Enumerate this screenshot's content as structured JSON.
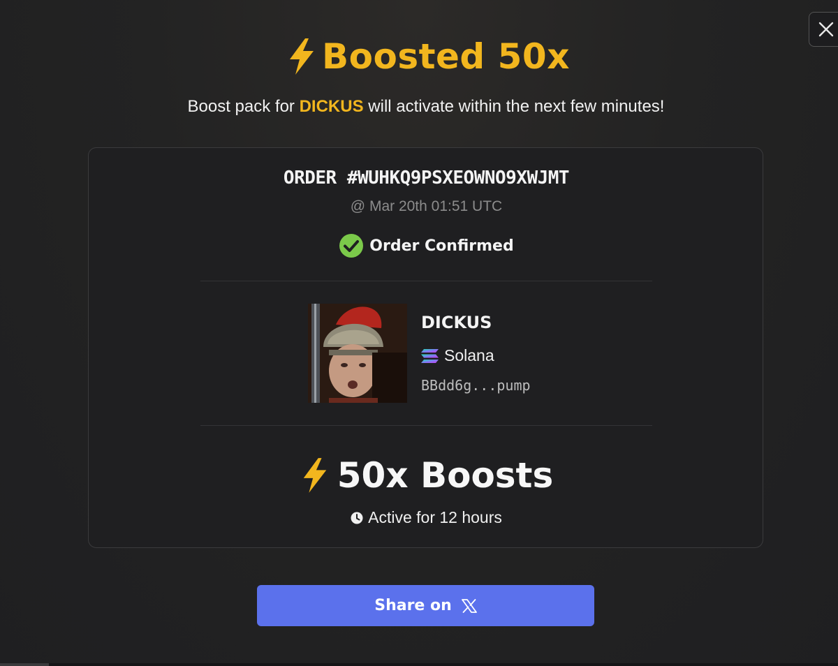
{
  "modal": {
    "title": "Boosted 50x",
    "subtitle_before": "Boost pack for ",
    "subtitle_token": "DICKUS",
    "subtitle_after": " will activate within the next few minutes!",
    "close_icon": "close-icon"
  },
  "order": {
    "id": "ORDER #WUHKQ9PSXEOWNO9XWJMT",
    "time": "@ Mar 20th 01:51 UTC",
    "status": "Order Confirmed",
    "status_color": "#7bc94a"
  },
  "token": {
    "name": "DICKUS",
    "chain": "Solana",
    "address": "BBdd6g...pump"
  },
  "boost": {
    "label": "50x Boosts",
    "duration": "Active for 12 hours"
  },
  "share": {
    "label": "Share on"
  },
  "colors": {
    "accent": "#f2b61e",
    "button": "#5b71ec"
  }
}
